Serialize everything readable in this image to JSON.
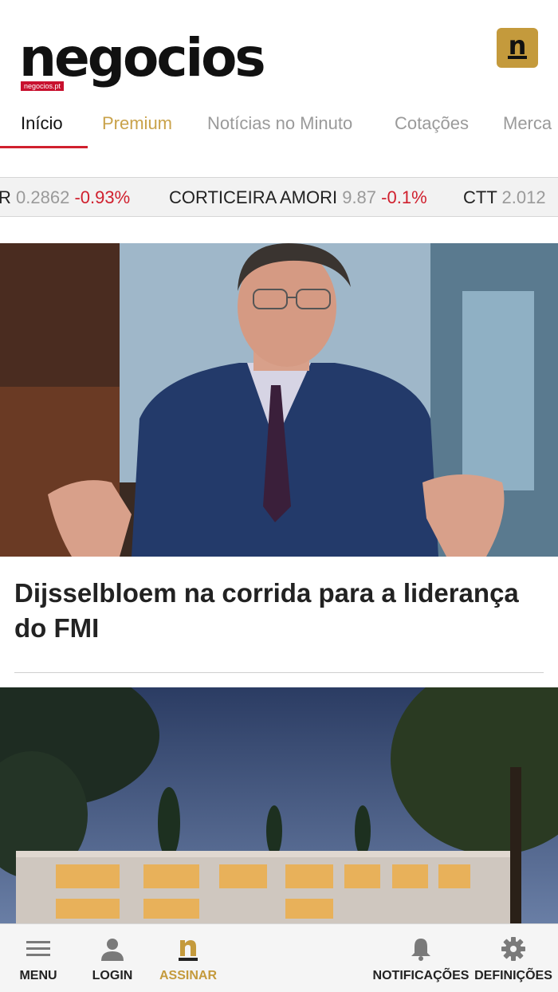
{
  "header": {
    "logo_text": "negocios",
    "logo_tag": "negocios.pt",
    "badge_letter": "n"
  },
  "tabs": [
    {
      "label": "Início"
    },
    {
      "label": "Premium"
    },
    {
      "label": "Notícias no Minuto"
    },
    {
      "label": "Cotações"
    },
    {
      "label": "Merca"
    }
  ],
  "ticker": [
    {
      "name": "R",
      "price": "0.2862",
      "change": "-0.93%"
    },
    {
      "name": "CORTICEIRA AMORI",
      "price": "9.87",
      "change": "-0.1%"
    },
    {
      "name": "CTT",
      "price": "2.012",
      "change": ""
    }
  ],
  "articles": [
    {
      "headline": "Dijsselbloem na corrida para a liderança do FMI"
    }
  ],
  "bottom_nav": [
    {
      "label": "MENU",
      "icon": "menu-icon"
    },
    {
      "label": "LOGIN",
      "icon": "user-icon"
    },
    {
      "label": "ASSINAR",
      "icon": "negocios-n-icon"
    },
    {
      "label": "NOTIFICAÇÕES",
      "icon": "bell-icon"
    },
    {
      "label": "DEFINIÇÕES",
      "icon": "gear-icon"
    }
  ],
  "colors": {
    "accent_red": "#d0202e",
    "gold": "#c49a3c"
  }
}
